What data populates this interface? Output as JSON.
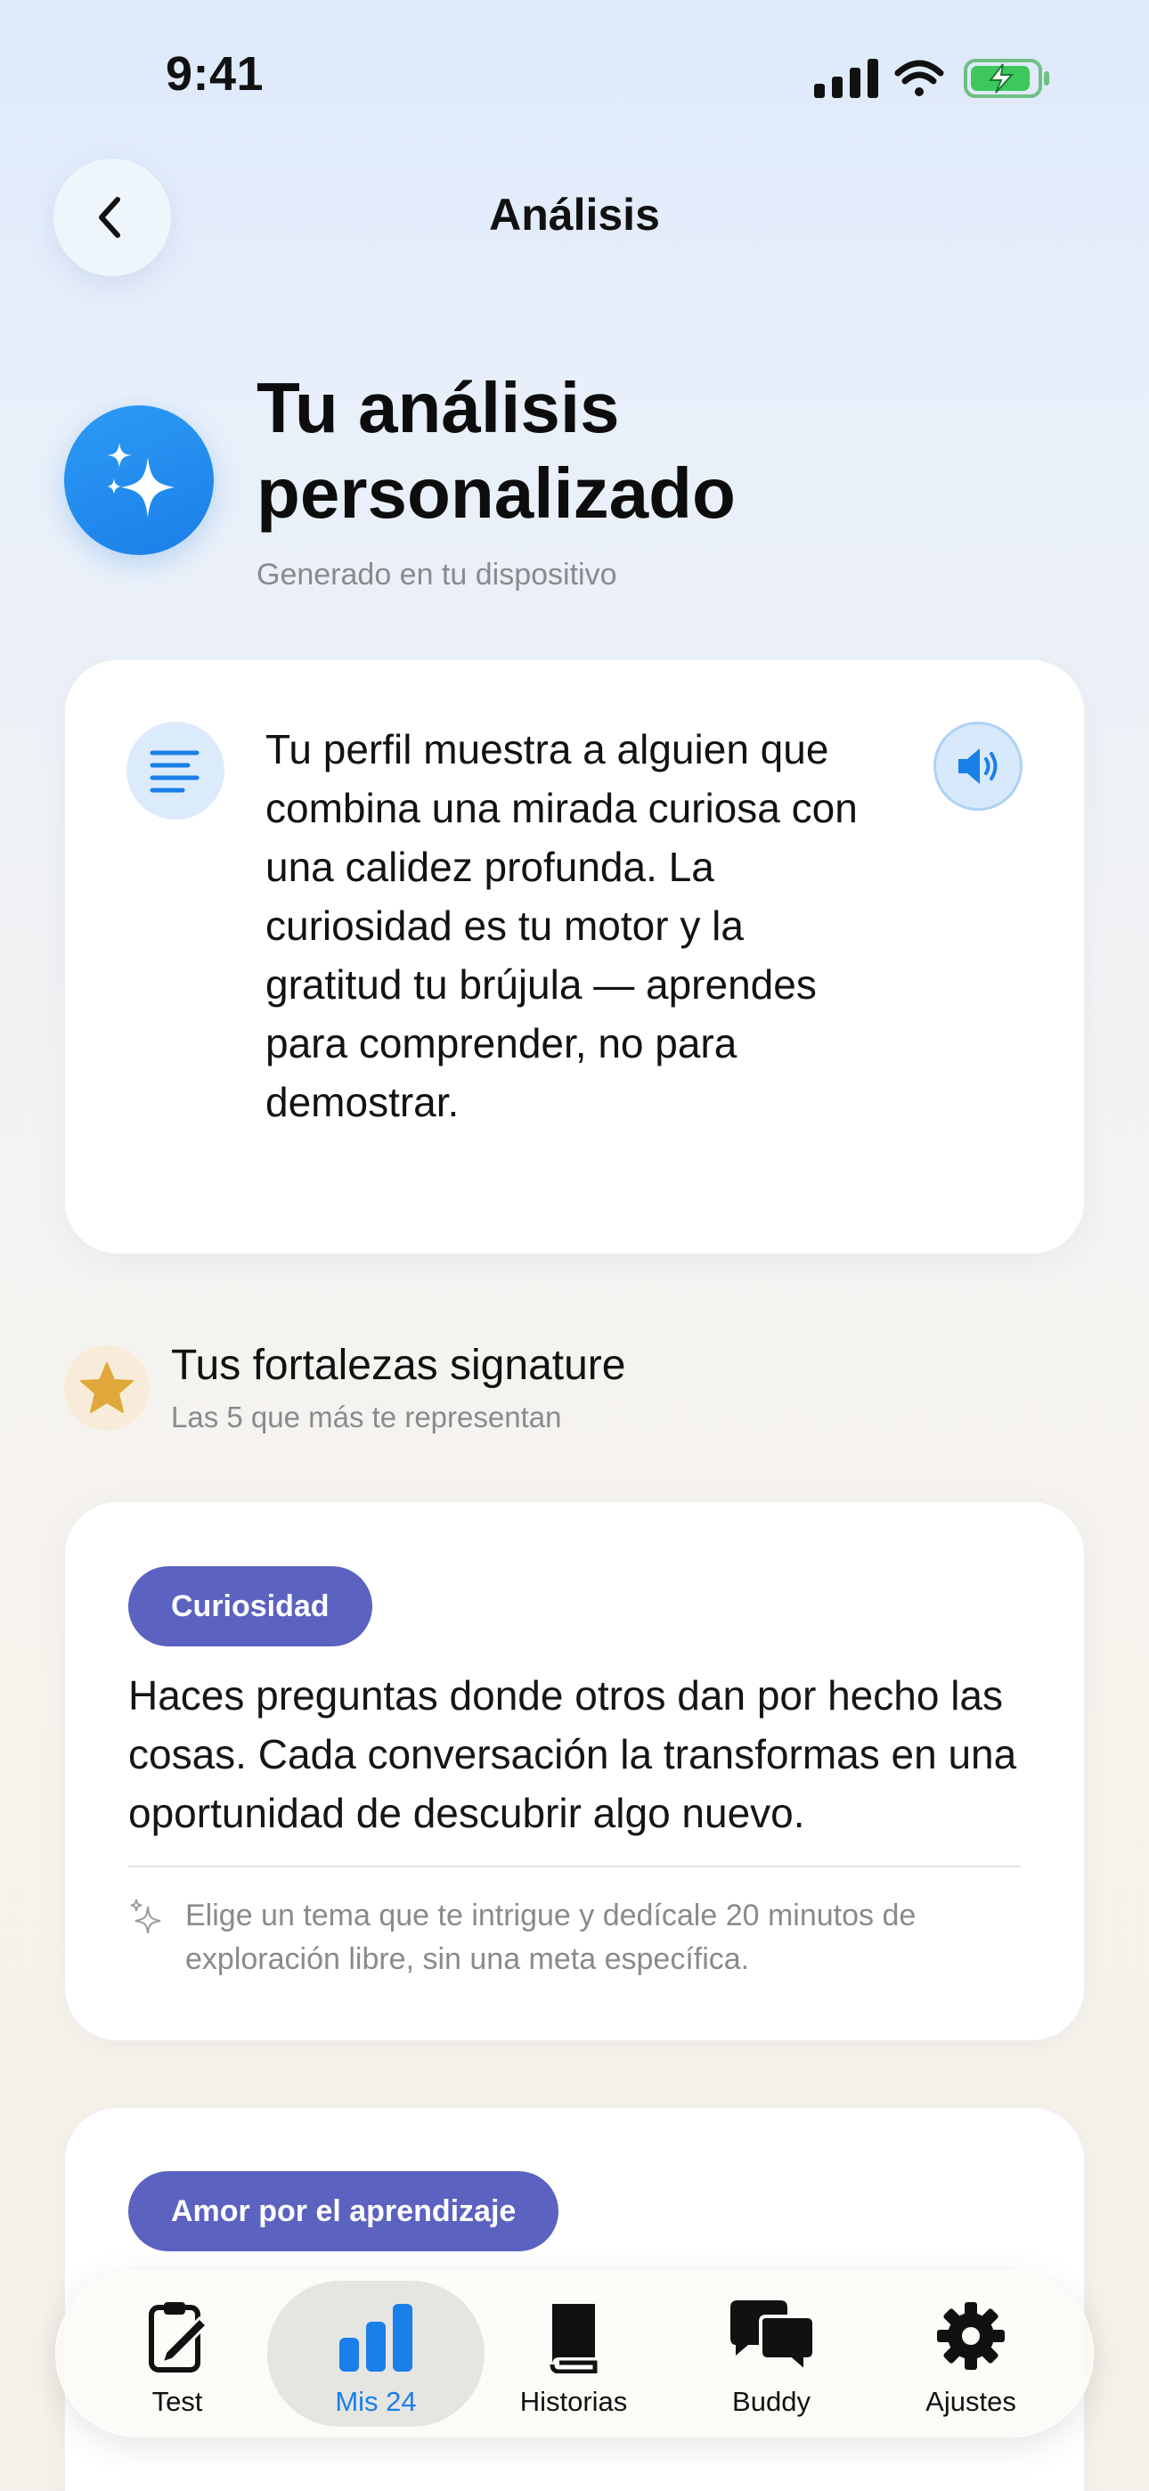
{
  "status_bar": {
    "time": "9:41"
  },
  "nav": {
    "title": "Análisis",
    "back_icon": "chevron-left-icon"
  },
  "header": {
    "title": "Tu análisis personalizado",
    "subtitle": "Generado en tu dispositivo",
    "icon": "sparkles-icon",
    "accent_color": "#1a7fe8"
  },
  "summary": {
    "text": "Tu perfil muestra a alguien que combina una mirada curiosa con una calidez profunda. La curiosidad es tu motor y la gratitud tu brújula — aprendes para comprender, no para demostrar.",
    "lead_icon": "text-lines-icon",
    "action_icon": "speaker-icon"
  },
  "strengths_section": {
    "title": "Tus fortalezas signature",
    "subtitle": "Las 5 que más te representan",
    "icon": "star-icon"
  },
  "strengths": [
    {
      "name": "Curiosidad",
      "description": "Haces preguntas donde otros dan por hecho las cosas. Cada conversación la transformas en una oportunidad de descubrir algo nuevo.",
      "tip": "Elige un tema que te intrigue y dedícale 20 minutos de exploración libre, sin una meta específica.",
      "pill_color": "#5b62bf"
    },
    {
      "name": "Amor por el aprendizaje",
      "pill_color": "#5b62bf"
    }
  ],
  "tabbar": {
    "active_color": "#1a7fe8",
    "tabs": [
      {
        "label": "Test",
        "icon": "clipboard-edit-icon",
        "active": false
      },
      {
        "label": "Mis 24",
        "icon": "bar-chart-icon",
        "active": true
      },
      {
        "label": "Historias",
        "icon": "book-icon",
        "active": false
      },
      {
        "label": "Buddy",
        "icon": "chat-bubbles-icon",
        "active": false
      },
      {
        "label": "Ajustes",
        "icon": "gear-icon",
        "active": false
      }
    ]
  }
}
